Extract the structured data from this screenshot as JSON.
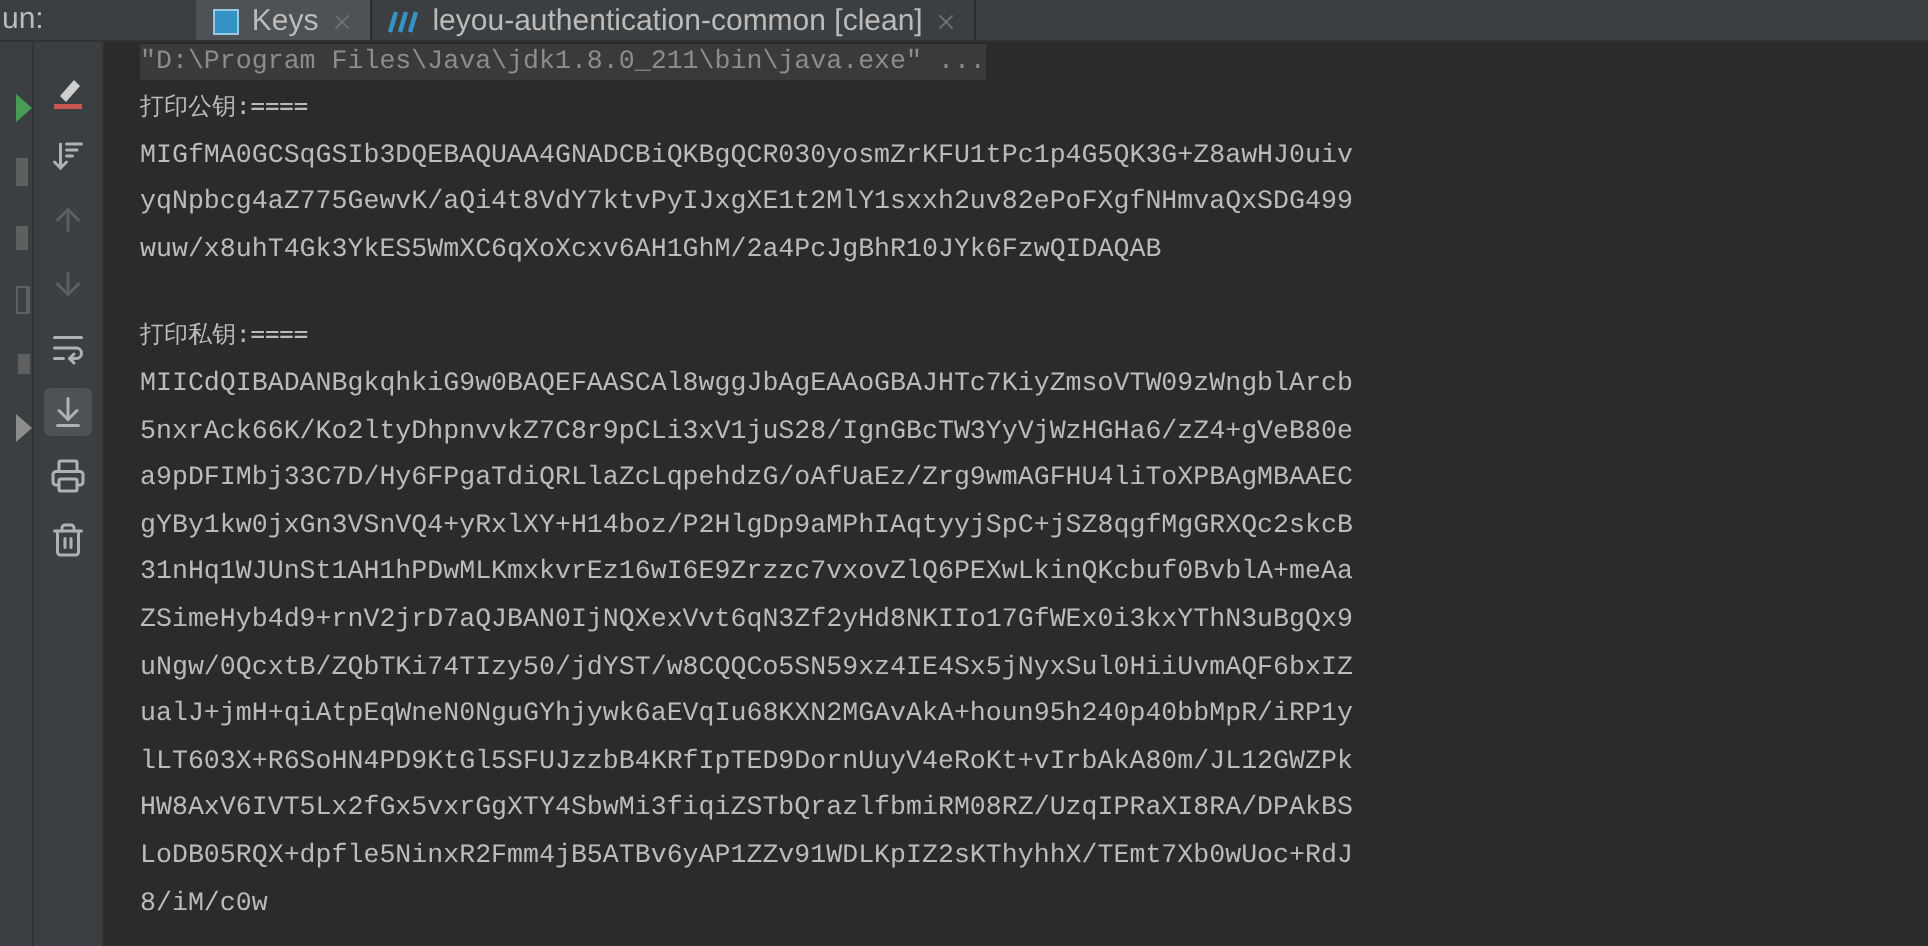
{
  "tool_window": {
    "label": "un:",
    "tabs": [
      {
        "label": "Keys",
        "selected": true,
        "kind": "class"
      },
      {
        "label": "leyou-authentication-common [clean]",
        "selected": false,
        "kind": "maven"
      }
    ]
  },
  "console": {
    "command": "\"D:\\Program Files\\Java\\jdk1.8.0_211\\bin\\java.exe\" ...",
    "sections": [
      {
        "heading": "打印公钥:====",
        "lines": [
          "MIGfMA0GCSqGSIb3DQEBAQUAA4GNADCBiQKBgQCR030yosmZrKFU1tPc1p4G5QK3G+Z8awHJ0uiv",
          "yqNpbcg4aZ775GewvK/aQi4t8VdY7ktvPyIJxgXE1t2MlY1sxxh2uv82ePoFXgfNHmvaQxSDG499",
          "wuw/x8uhT4Gk3YkES5WmXC6qXoXcxv6AH1GhM/2a4PcJgBhR10JYk6FzwQIDAQAB"
        ]
      },
      {
        "heading": "打印私钥:====",
        "lines": [
          "MIICdQIBADANBgkqhkiG9w0BAQEFAASCAl8wggJbAgEAAoGBAJHTc7KiyZmsoVTW09zWngblArcb",
          "5nxrAck66K/Ko2ltyDhpnvvkZ7C8r9pCLi3xV1juS28/IgnGBcTW3YyVjWzHGHa6/zZ4+gVeB80e",
          "a9pDFIMbj33C7D/Hy6FPgaTdiQRLlaZcLqpehdzG/oAfUaEz/Zrg9wmAGFHU4liToXPBAgMBAAEC",
          "gYBy1kw0jxGn3VSnVQ4+yRxlXY+H14boz/P2HlgDp9aMPhIAqtyyjSpC+jSZ8qgfMgGRXQc2skcB",
          "31nHq1WJUnSt1AH1hPDwMLKmxkvrEz16wI6E9Zrzzc7vxovZlQ6PEXwLkinQKcbuf0BvblA+meAa",
          "ZSimeHyb4d9+rnV2jrD7aQJBAN0IjNQXexVvt6qN3Zf2yHd8NKIIo17GfWEx0i3kxYThN3uBgQx9",
          "uNgw/0QcxtB/ZQbTKi74TIzy50/jdYST/w8CQQCo5SN59xz4IE4Sx5jNyxSul0HiiUvmAQF6bxIZ",
          "ualJ+jmH+qiAtpEqWneN0NguGYhjywk6aEVqIu68KXN2MGAvAkA+houn95h240p40bbMpR/iRP1y",
          "lLT603X+R6SoHN4PD9KtGl5SFUJzzbB4KRfIpTED9DornUuyV4eRoKt+vIrbAkA80m/JL12GWZPk",
          "HW8AxV6IVT5Lx2fGx5vxrGgXTY4SbwMi3fiqiZSTbQrazlfbmiRM08RZ/UzqIPRaXI8RA/DPAkBS",
          "LoDB05RQX+dpfle5NinxR2Fmm4jB5ATBv6yAP1ZZv91WDLKpIZ2sKThyhhX/TEmt7Xb0wUoc+RdJ",
          "8/iM/c0w"
        ]
      }
    ]
  }
}
